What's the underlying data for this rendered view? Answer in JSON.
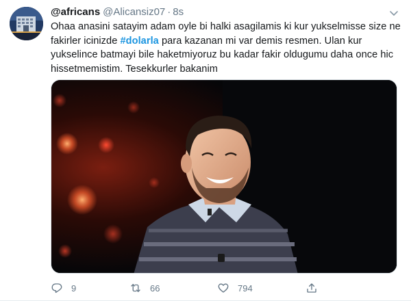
{
  "tweet": {
    "display_name": "@africans",
    "handle": "@Alicansiz07",
    "separator": "·",
    "time": "8s",
    "text_part1": "Ohaa anasini satayim adam oyle bi halki asagilamis ki kur yukselmisse size ne fakirler icinizde ",
    "hashtag": "#dolarla",
    "text_part2": " para kazanan mi var demis resmen. Ulan kur yukselince batmayi bile haketmiyoruz bu kadar fakir oldugumu daha once hic hissetmemistim. Tesekkurler bakanim",
    "media_description": "photo",
    "accent_color": "#1b95e0"
  },
  "actions": {
    "reply_icon": "reply-icon",
    "reply_count": "9",
    "retweet_icon": "retweet-icon",
    "retweet_count": "66",
    "like_icon": "heart-icon",
    "like_count": "794",
    "share_icon": "share-icon"
  }
}
